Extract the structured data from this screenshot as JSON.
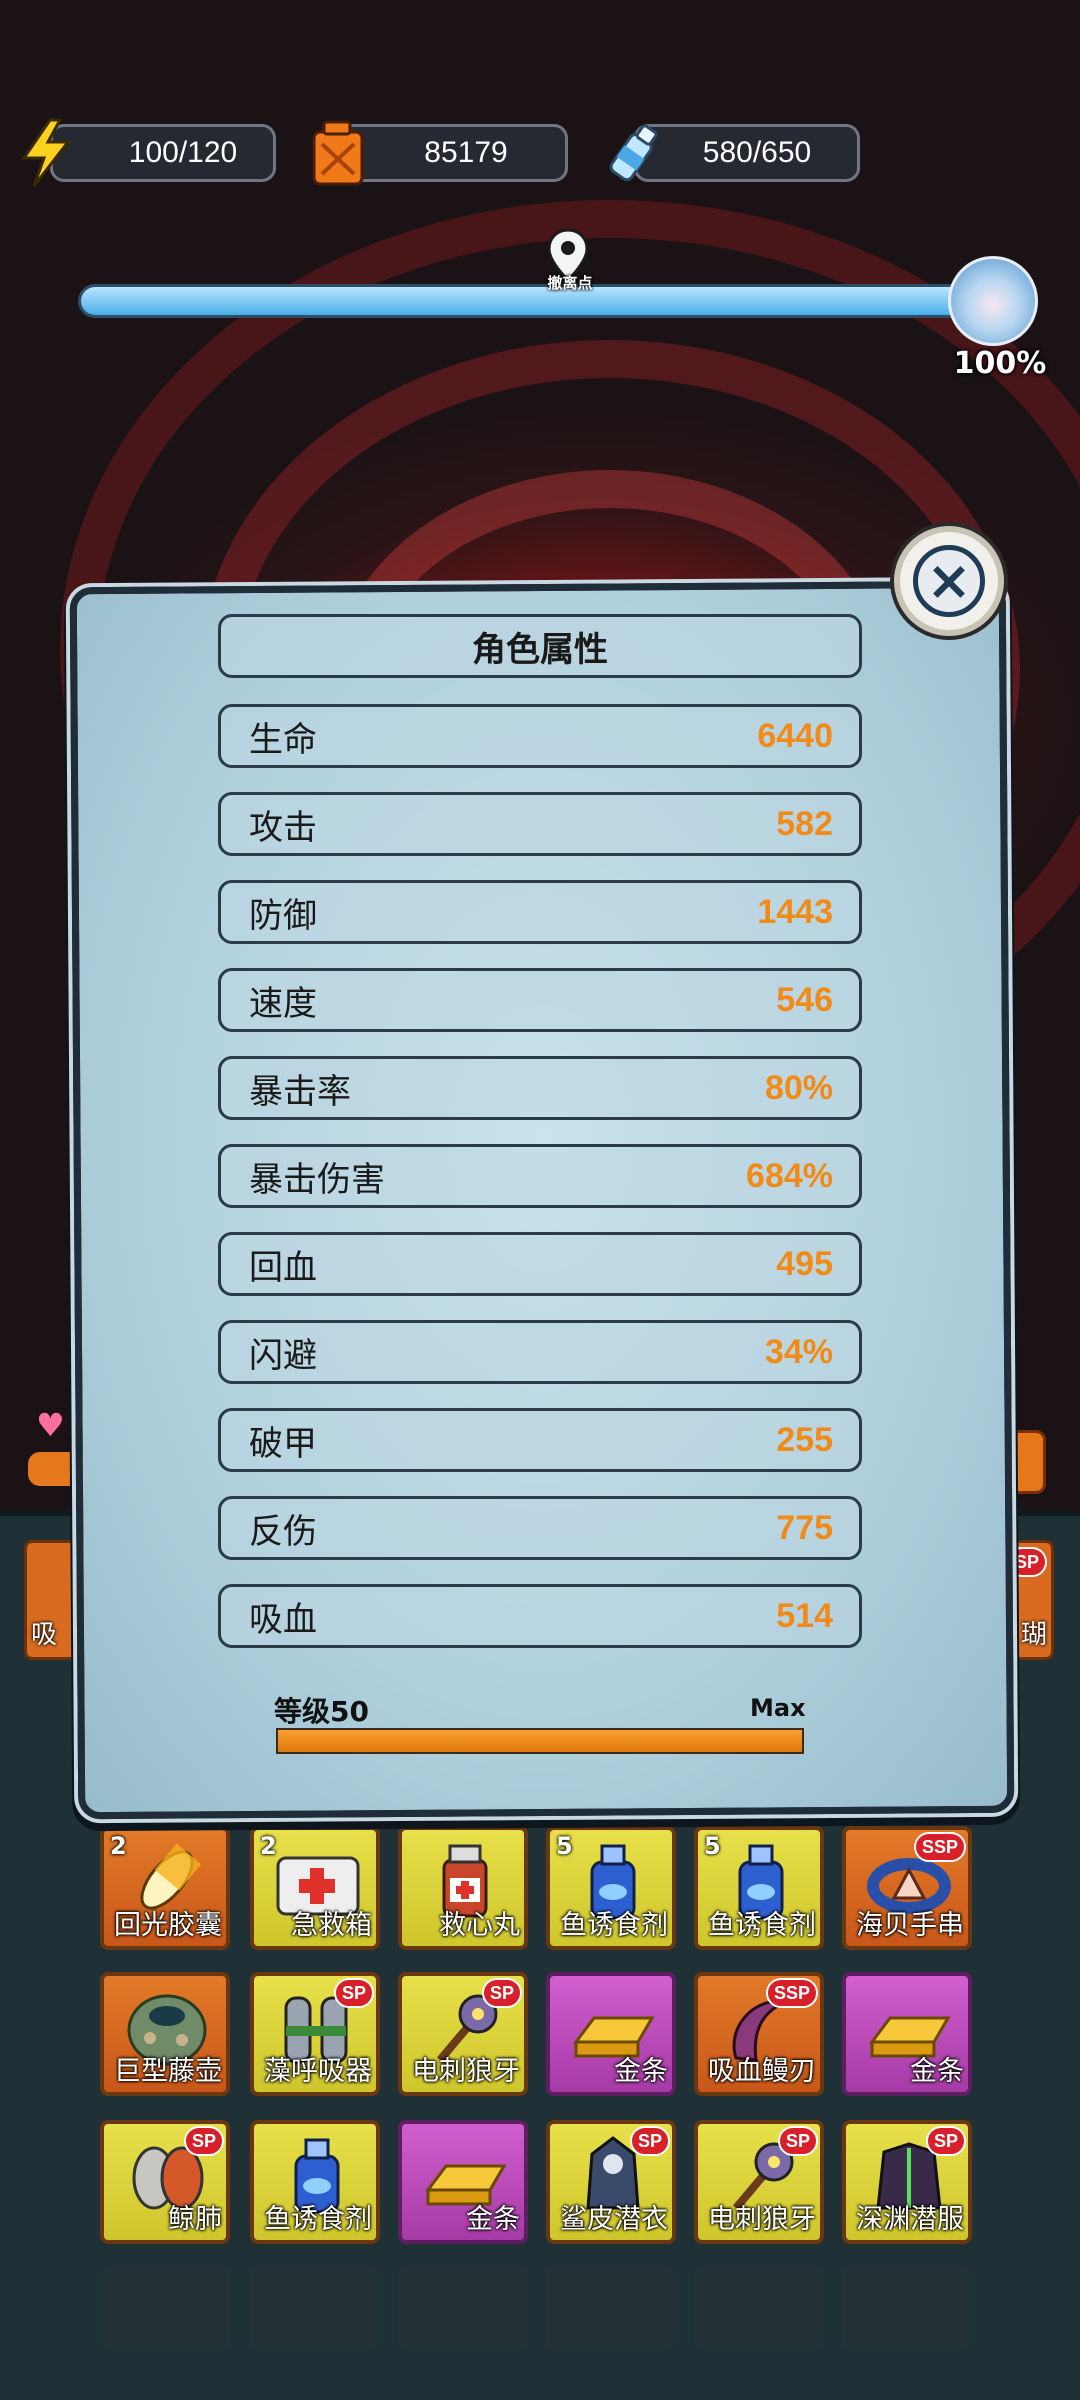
{
  "resources": {
    "energy": "100/120",
    "fuel": "85179",
    "water": "580/650"
  },
  "route": {
    "pin_label": "撤离点",
    "progress_fraction": 1.0,
    "percent_text": "100%"
  },
  "side": {
    "left_item_label": "吸",
    "right_item_label": "瑚",
    "right_badge": "SP"
  },
  "panel": {
    "title": "角色属性",
    "stats": [
      {
        "name": "生命",
        "value": "6440"
      },
      {
        "name": "攻击",
        "value": "582"
      },
      {
        "name": "防御",
        "value": "1443"
      },
      {
        "name": "速度",
        "value": "546"
      },
      {
        "name": "暴击率",
        "value": "80%"
      },
      {
        "name": "暴击伤害",
        "value": "684%"
      },
      {
        "name": "回血",
        "value": "495"
      },
      {
        "name": "闪避",
        "value": "34%"
      },
      {
        "name": "破甲",
        "value": "255"
      },
      {
        "name": "反伤",
        "value": "775"
      },
      {
        "name": "吸血",
        "value": "514"
      }
    ],
    "level_label": "等级50",
    "max_label": "Max",
    "level_fraction": 1.0
  },
  "inventory": {
    "items": [
      {
        "name": "回光胶囊",
        "count": "2",
        "badge": "",
        "color": "orange",
        "icon": "capsule-icon"
      },
      {
        "name": "急救箱",
        "count": "2",
        "badge": "",
        "color": "yellow",
        "icon": "first-aid-kit-icon"
      },
      {
        "name": "救心丸",
        "count": "",
        "badge": "",
        "color": "yellow",
        "icon": "medicine-bottle-icon"
      },
      {
        "name": "鱼诱食剂",
        "count": "5",
        "badge": "",
        "color": "yellow",
        "icon": "blue-bottle-icon"
      },
      {
        "name": "鱼诱食剂",
        "count": "5",
        "badge": "",
        "color": "yellow",
        "icon": "blue-bottle-icon"
      },
      {
        "name": "海贝手串",
        "count": "",
        "badge": "SSP",
        "color": "orange",
        "icon": "shell-bracelet-icon"
      },
      {
        "name": "巨型藤壶",
        "count": "",
        "badge": "",
        "color": "orange",
        "icon": "barnacle-icon"
      },
      {
        "name": "藻呼吸器",
        "count": "",
        "badge": "SP",
        "color": "yellow",
        "icon": "oxygen-tank-icon"
      },
      {
        "name": "电刺狼牙",
        "count": "",
        "badge": "SP",
        "color": "yellow",
        "icon": "spiked-mace-icon"
      },
      {
        "name": "金条",
        "count": "",
        "badge": "",
        "color": "purple",
        "icon": "gold-bar-icon"
      },
      {
        "name": "吸血鳗刃",
        "count": "",
        "badge": "SSP",
        "color": "orange",
        "icon": "eel-blade-icon"
      },
      {
        "name": "金条",
        "count": "",
        "badge": "",
        "color": "purple",
        "icon": "gold-bar-icon"
      },
      {
        "name": "鲸肺",
        "count": "",
        "badge": "SP",
        "color": "yellow",
        "icon": "whale-lung-icon"
      },
      {
        "name": "鱼诱食剂",
        "count": "",
        "badge": "",
        "color": "yellow",
        "icon": "blue-bottle-icon"
      },
      {
        "name": "金条",
        "count": "",
        "badge": "",
        "color": "purple",
        "icon": "gold-bar-icon"
      },
      {
        "name": "鲨皮潜衣",
        "count": "",
        "badge": "SP",
        "color": "yellow",
        "icon": "shark-suit-icon"
      },
      {
        "name": "电刺狼牙",
        "count": "",
        "badge": "SP",
        "color": "yellow",
        "icon": "spiked-mace-icon"
      },
      {
        "name": "深渊潜服",
        "count": "",
        "badge": "SP",
        "color": "yellow",
        "icon": "abyss-suit-icon"
      }
    ]
  }
}
